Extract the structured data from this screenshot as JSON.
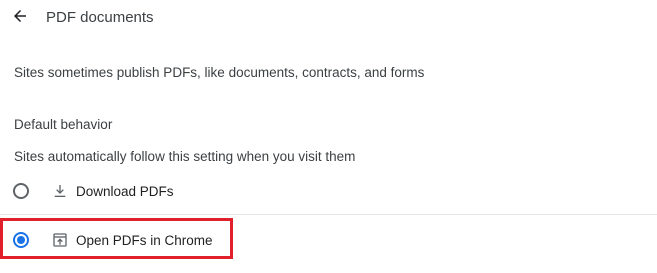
{
  "header": {
    "back_icon": "arrow-back-icon",
    "title": "PDF documents"
  },
  "description": "Sites sometimes publish PDFs, like documents, contracts, and forms",
  "default_behavior": {
    "heading": "Default behavior",
    "subtitle": "Sites automatically follow this setting when you visit them",
    "options": [
      {
        "label": "Download PDFs",
        "icon": "download-icon",
        "selected": false
      },
      {
        "label": "Open PDFs in Chrome",
        "icon": "open-in-browser-icon",
        "selected": true
      }
    ]
  },
  "colors": {
    "accent": "#1a73e8",
    "highlight": "#e0202a",
    "text": "#3c4043"
  }
}
